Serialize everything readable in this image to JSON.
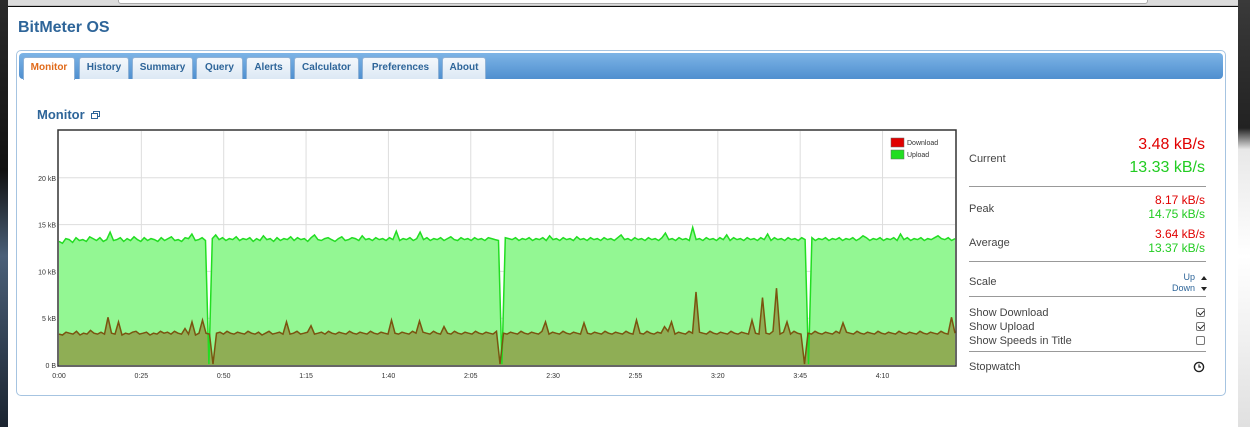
{
  "app": {
    "title": "BitMeter OS"
  },
  "tabs": [
    {
      "label": "Monitor",
      "active": true
    },
    {
      "label": "History"
    },
    {
      "label": "Summary"
    },
    {
      "label": "Query"
    },
    {
      "label": "Alerts"
    },
    {
      "label": "Calculator"
    },
    {
      "label": "Preferences"
    },
    {
      "label": "About"
    }
  ],
  "monitor": {
    "title": "Monitor",
    "popout_icon": "popout-window-icon"
  },
  "colors": {
    "download": "#e00000",
    "upload": "#22dd22",
    "upload_fill": "#93f793",
    "overlap_fill": "#8fae55",
    "accent": "#2e6599",
    "active_tab": "#e06a1a"
  },
  "chart_data": {
    "type": "area",
    "legend": [
      {
        "name": "Download",
        "color": "#e00000"
      },
      {
        "name": "Upload",
        "color": "#22dd22"
      }
    ],
    "legend_position": "top-right",
    "x_ticks": [
      "0:00",
      "0:25",
      "0:50",
      "1:15",
      "1:40",
      "2:05",
      "2:30",
      "2:55",
      "3:20",
      "3:45",
      "4:10"
    ],
    "y_ticks": [
      "0 B",
      "5 kB",
      "10 kB",
      "15 kB",
      "20 kB"
    ],
    "x_range_seconds": [
      0,
      272
    ],
    "ylim_kB": [
      0,
      25
    ],
    "grid": true,
    "series": [
      {
        "name": "Upload",
        "unit": "kB/s",
        "values": [
          13.2,
          13.0,
          13.5,
          13.4,
          13.1,
          13.6,
          13.3,
          13.4,
          13.2,
          13.7,
          13.5,
          13.3,
          13.6,
          13.2,
          13.4,
          14.2,
          13.3,
          13.4,
          13.6,
          13.2,
          13.5,
          13.3,
          13.7,
          13.4,
          13.2,
          13.6,
          13.3,
          13.5,
          13.4,
          13.2,
          13.6,
          13.3,
          13.5,
          13.7,
          13.3,
          13.4,
          13.2,
          13.6,
          13.5,
          14.0,
          13.3,
          13.4,
          13.6,
          13.3,
          0.1,
          13.5,
          13.9,
          13.4,
          13.6,
          13.3,
          13.5,
          13.4,
          13.7,
          13.3,
          13.5,
          13.4,
          13.6,
          13.2,
          13.5,
          13.3,
          13.8,
          13.4,
          13.5,
          13.2,
          13.6,
          13.3,
          13.5,
          13.4,
          13.7,
          13.3,
          13.6,
          13.4,
          13.5,
          13.2,
          13.6,
          13.9,
          13.4,
          13.3,
          13.5,
          13.6,
          13.4,
          13.2,
          13.5,
          13.7,
          13.3,
          13.4,
          13.6,
          13.5,
          13.3,
          13.8,
          13.4,
          13.5,
          13.3,
          13.6,
          13.4,
          13.5,
          13.3,
          13.6,
          13.4,
          14.3,
          13.3,
          13.5,
          13.4,
          13.6,
          13.3,
          13.5,
          14.2,
          13.4,
          13.6,
          13.3,
          13.5,
          13.4,
          13.6,
          13.3,
          13.5,
          13.7,
          13.4,
          13.3,
          13.6,
          13.4,
          13.5,
          13.3,
          13.6,
          13.4,
          13.5,
          13.3,
          13.6,
          13.5,
          13.4,
          13.3,
          0.1,
          13.6,
          13.5,
          13.4,
          13.6,
          13.3,
          13.5,
          13.4,
          13.6,
          13.3,
          13.5,
          13.4,
          13.6,
          13.3,
          13.8,
          13.4,
          13.5,
          13.3,
          13.6,
          13.4,
          13.5,
          13.3,
          13.7,
          13.4,
          13.5,
          13.3,
          13.6,
          13.4,
          13.5,
          13.3,
          13.6,
          13.4,
          13.5,
          13.3,
          13.6,
          13.9,
          13.4,
          13.5,
          13.3,
          13.6,
          13.4,
          13.5,
          13.3,
          13.6,
          13.4,
          13.5,
          13.3,
          13.6,
          14.1,
          13.4,
          13.5,
          13.3,
          13.6,
          13.4,
          13.5,
          13.3,
          14.7,
          13.4,
          13.5,
          13.3,
          13.6,
          13.4,
          13.5,
          13.3,
          13.6,
          13.4,
          13.9,
          13.3,
          13.6,
          13.4,
          13.5,
          13.3,
          13.6,
          13.4,
          13.5,
          13.3,
          13.6,
          13.4,
          14.0,
          13.3,
          13.6,
          13.4,
          13.5,
          13.3,
          13.6,
          13.4,
          13.5,
          13.3,
          13.6,
          13.4,
          0.1,
          13.6,
          13.3,
          13.5,
          13.4,
          13.6,
          13.3,
          13.5,
          13.4,
          13.6,
          13.3,
          13.5,
          13.4,
          13.6,
          13.3,
          13.5,
          13.8,
          13.6,
          13.3,
          13.5,
          13.4,
          13.6,
          13.3,
          13.5,
          13.4,
          13.6,
          13.3,
          14.0,
          13.4,
          13.6,
          13.3,
          13.5,
          13.4,
          13.6,
          13.3,
          13.5,
          13.4,
          13.6,
          13.8,
          13.5,
          13.4,
          13.6,
          13.3,
          13.5
        ]
      },
      {
        "name": "Download",
        "unit": "kB/s",
        "values": [
          3.3,
          3.2,
          3.5,
          3.4,
          3.3,
          3.6,
          3.2,
          3.4,
          3.3,
          3.7,
          3.4,
          3.3,
          3.5,
          3.3,
          5.1,
          3.4,
          3.3,
          4.6,
          3.2,
          3.4,
          3.3,
          3.5,
          3.6,
          3.3,
          3.4,
          3.5,
          3.2,
          3.4,
          3.3,
          3.6,
          3.4,
          3.5,
          3.3,
          3.6,
          3.4,
          3.3,
          3.9,
          3.3,
          4.6,
          3.2,
          3.4,
          4.8,
          3.4,
          3.3,
          0.1,
          3.4,
          3.5,
          3.3,
          3.6,
          3.4,
          3.3,
          3.5,
          3.4,
          3.3,
          3.6,
          3.4,
          3.3,
          3.5,
          3.2,
          3.4,
          3.6,
          3.3,
          3.4,
          3.5,
          3.3,
          4.6,
          3.3,
          3.4,
          3.6,
          3.3,
          3.4,
          3.5,
          4.2,
          3.3,
          3.4,
          3.5,
          3.3,
          3.6,
          3.4,
          3.3,
          3.5,
          3.4,
          3.3,
          3.6,
          3.4,
          3.3,
          3.5,
          3.4,
          3.3,
          3.6,
          3.4,
          3.3,
          3.5,
          3.4,
          3.3,
          4.8,
          3.4,
          3.3,
          3.5,
          3.4,
          3.3,
          3.6,
          3.4,
          4.7,
          3.5,
          3.4,
          3.3,
          3.6,
          3.4,
          3.3,
          4.1,
          3.4,
          3.3,
          3.6,
          3.4,
          3.3,
          3.5,
          3.4,
          3.3,
          3.6,
          3.4,
          3.3,
          3.5,
          3.4,
          3.3,
          3.6,
          0.1,
          3.4,
          3.3,
          3.5,
          3.4,
          3.3,
          3.6,
          3.4,
          3.3,
          3.5,
          3.4,
          3.3,
          3.6,
          4.6,
          3.3,
          3.5,
          3.4,
          3.3,
          3.6,
          3.4,
          3.3,
          3.5,
          3.4,
          3.3,
          4.5,
          3.4,
          3.3,
          3.5,
          3.4,
          3.3,
          3.6,
          3.4,
          3.3,
          3.5,
          3.4,
          3.3,
          3.6,
          3.4,
          3.3,
          4.8,
          3.4,
          3.3,
          3.6,
          3.4,
          3.3,
          3.5,
          3.4,
          4.1,
          3.6,
          4.6,
          3.3,
          3.5,
          3.4,
          3.3,
          3.6,
          3.4,
          7.8,
          3.5,
          3.4,
          3.3,
          3.6,
          3.4,
          3.3,
          3.5,
          3.4,
          3.3,
          3.6,
          3.4,
          3.3,
          3.5,
          3.4,
          3.3,
          4.8,
          3.4,
          3.3,
          7.2,
          3.4,
          3.3,
          3.6,
          8.2,
          3.3,
          3.5,
          4.6,
          3.3,
          3.6,
          3.4,
          3.3,
          0.1,
          3.4,
          3.3,
          3.6,
          3.4,
          3.3,
          3.5,
          3.4,
          3.3,
          3.6,
          3.4,
          4.5,
          3.5,
          3.4,
          3.3,
          3.6,
          3.4,
          3.3,
          3.5,
          3.4,
          3.3,
          3.6,
          3.4,
          3.3,
          3.5,
          3.4,
          3.3,
          3.6,
          3.4,
          3.3,
          3.5,
          3.4,
          3.3,
          3.6,
          3.4,
          3.3,
          3.5,
          3.4,
          3.3,
          3.6,
          3.4,
          3.3,
          5.1,
          3.4
        ]
      }
    ]
  },
  "stats": {
    "current_label": "Current",
    "current_download": "3.48 kB/s",
    "current_upload": "13.33 kB/s",
    "peak_label": "Peak",
    "peak_download": "8.17 kB/s",
    "peak_upload": "14.75 kB/s",
    "average_label": "Average",
    "average_download": "3.64 kB/s",
    "average_upload": "13.37 kB/s",
    "scale_label": "Scale",
    "scale_up": "Up",
    "scale_down": "Down",
    "show_download_label": "Show Download",
    "show_download_checked": true,
    "show_upload_label": "Show Upload",
    "show_upload_checked": true,
    "show_speeds_label": "Show Speeds in Title",
    "show_speeds_checked": false,
    "stopwatch_label": "Stopwatch",
    "stopwatch_icon": "stopwatch-icon"
  }
}
